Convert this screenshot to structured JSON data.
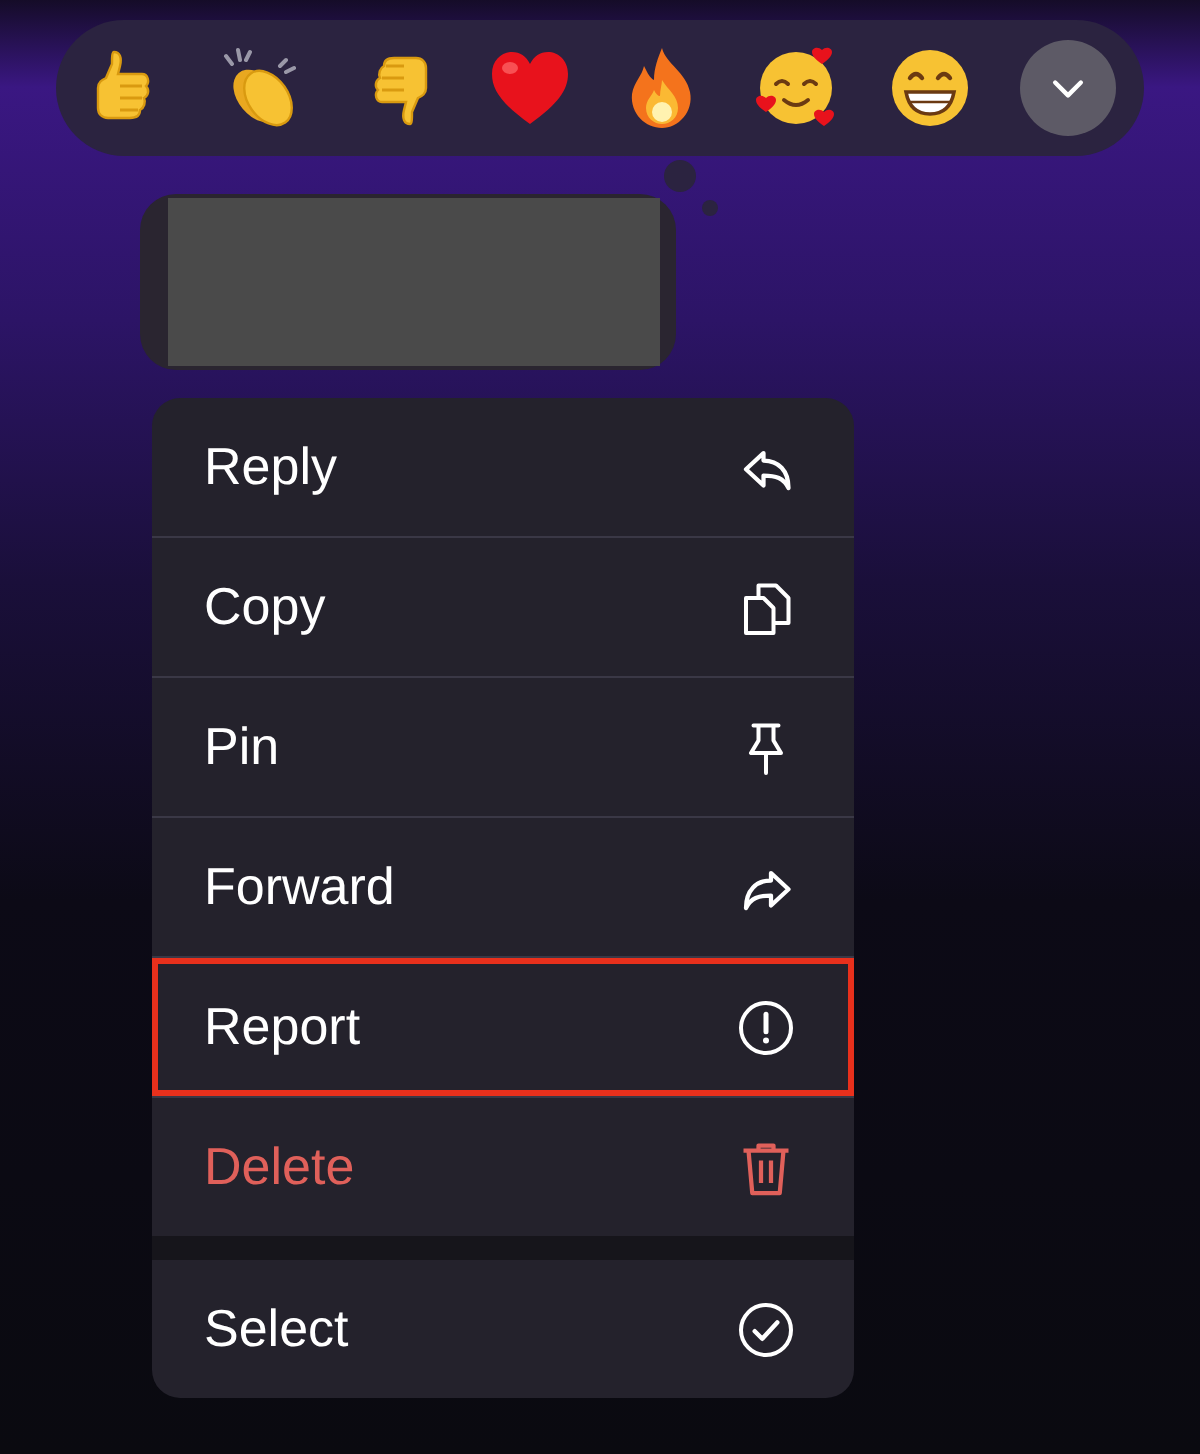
{
  "reactions": [
    {
      "kind": "thumbs_up"
    },
    {
      "kind": "clap"
    },
    {
      "kind": "thumbs_down"
    },
    {
      "kind": "heart"
    },
    {
      "kind": "fire"
    },
    {
      "kind": "smile_hearts"
    },
    {
      "kind": "grin"
    },
    {
      "kind": "more"
    }
  ],
  "message": {
    "kind": "redacted"
  },
  "menu": {
    "sections": [
      {
        "items": [
          {
            "label": "Reply",
            "kind": "reply",
            "destructive": false,
            "highlighted": false
          },
          {
            "label": "Copy",
            "kind": "copy",
            "destructive": false,
            "highlighted": false
          },
          {
            "label": "Pin",
            "kind": "pin",
            "destructive": false,
            "highlighted": false
          },
          {
            "label": "Forward",
            "kind": "forward",
            "destructive": false,
            "highlighted": false
          },
          {
            "label": "Report",
            "kind": "report",
            "destructive": false,
            "highlighted": true
          },
          {
            "label": "Delete",
            "kind": "delete",
            "destructive": true,
            "highlighted": false
          }
        ]
      },
      {
        "items": [
          {
            "label": "Select",
            "kind": "select",
            "destructive": false,
            "highlighted": false
          }
        ]
      }
    ]
  }
}
